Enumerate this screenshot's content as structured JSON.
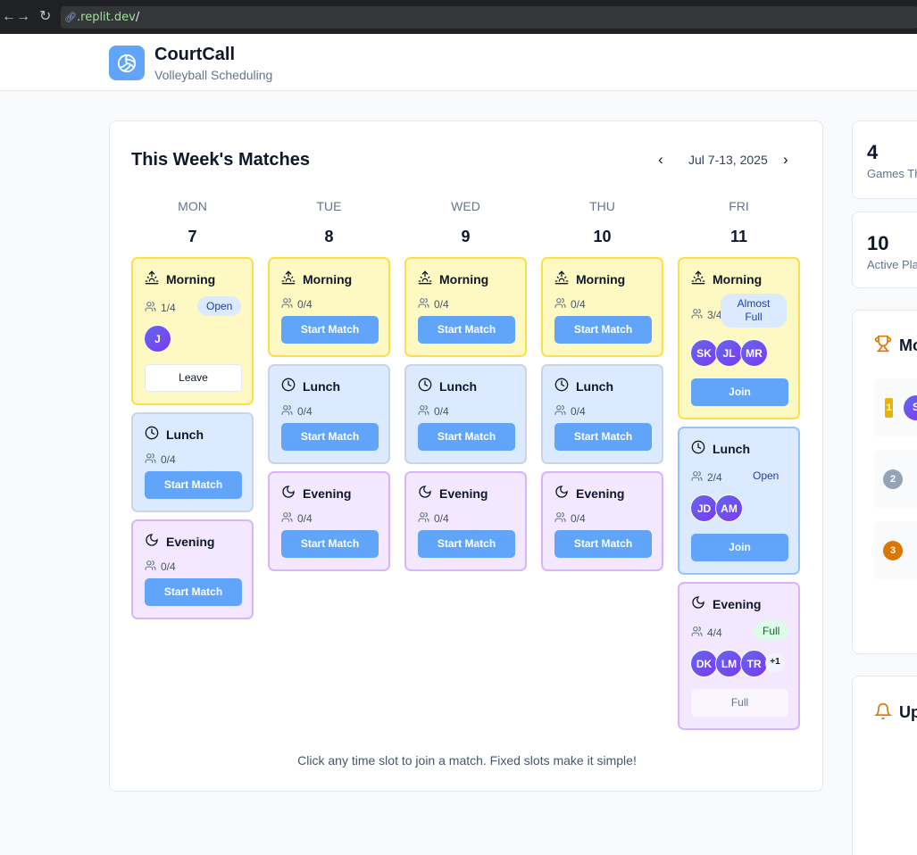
{
  "browser": {
    "url": ".replit.dev",
    "url_suffix": "/"
  },
  "app": {
    "title": "CourtCall",
    "subtitle": "Volleyball Scheduling"
  },
  "schedule": {
    "title": "This Week's Matches",
    "week_label": "Jul 7-13, 2025",
    "hint": "Click any time slot to join a match. Fixed slots make it simple!"
  },
  "days": [
    {
      "name": "MON",
      "num": "7",
      "slots": [
        {
          "label": "Morning",
          "count": "1/4",
          "badge": "Open",
          "avatars": [
            "J"
          ],
          "action": "Leave"
        },
        {
          "label": "Lunch",
          "count": "0/4",
          "action": "Start Match"
        },
        {
          "label": "Evening",
          "count": "0/4",
          "action": "Start Match"
        }
      ]
    },
    {
      "name": "TUE",
      "num": "8",
      "slots": [
        {
          "label": "Morning",
          "count": "0/4",
          "action": "Start Match"
        },
        {
          "label": "Lunch",
          "count": "0/4",
          "action": "Start Match"
        },
        {
          "label": "Evening",
          "count": "0/4",
          "action": "Start Match"
        }
      ]
    },
    {
      "name": "WED",
      "num": "9",
      "slots": [
        {
          "label": "Morning",
          "count": "0/4",
          "action": "Start Match"
        },
        {
          "label": "Lunch",
          "count": "0/4",
          "action": "Start Match"
        },
        {
          "label": "Evening",
          "count": "0/4",
          "action": "Start Match"
        }
      ]
    },
    {
      "name": "THU",
      "num": "10",
      "slots": [
        {
          "label": "Morning",
          "count": "0/4",
          "action": "Start Match"
        },
        {
          "label": "Lunch",
          "count": "0/4",
          "action": "Start Match"
        },
        {
          "label": "Evening",
          "count": "0/4",
          "action": "Start Match"
        }
      ]
    },
    {
      "name": "FRI",
      "num": "11",
      "slots": [
        {
          "label": "Morning",
          "count": "3/4",
          "badge": "Almost Full",
          "avatars": [
            "SK",
            "JL",
            "MR"
          ],
          "action": "Join"
        },
        {
          "label": "Lunch",
          "count": "2/4",
          "badge": "Open",
          "avatars": [
            "JD",
            "AM"
          ],
          "action": "Join"
        },
        {
          "label": "Evening",
          "count": "4/4",
          "badge": "Full",
          "avatars": [
            "DK",
            "LM",
            "TR"
          ],
          "extra": "+1",
          "action": "Full"
        }
      ]
    }
  ],
  "stats": [
    {
      "value": "4",
      "label": "Games Th"
    },
    {
      "value": "10",
      "label": "Active Pla"
    }
  ],
  "leaderboard": {
    "title": "Mo",
    "ranks": [
      "1",
      "2",
      "3"
    ],
    "first_initial": "S"
  },
  "upcoming": {
    "title": "Up"
  },
  "colors": {
    "accent": "#60a5fa",
    "morning": "#fef9c3",
    "lunch": "#dbeafe",
    "evening": "#f3e8ff"
  },
  "icons": {
    "morning": "sunrise-icon",
    "lunch": "clock-icon",
    "evening": "moon-icon",
    "players": "users-icon"
  }
}
